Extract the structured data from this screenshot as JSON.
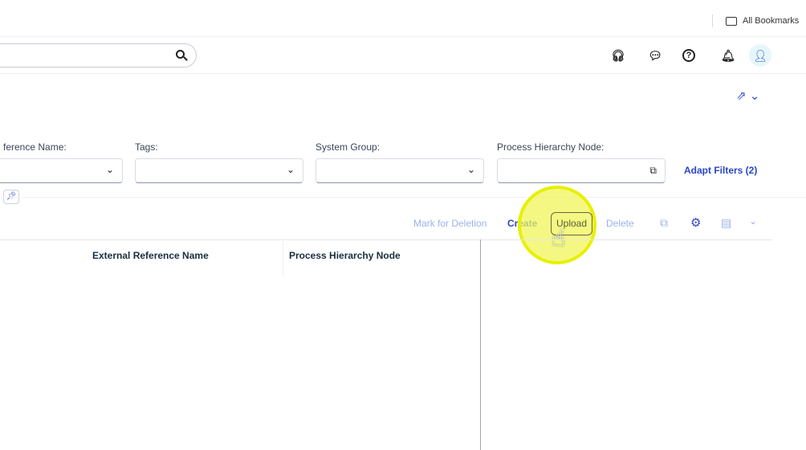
{
  "bookmarks": {
    "label": "All Bookmarks"
  },
  "shell": {
    "icons": [
      "headset-icon",
      "feedback-icon",
      "help-icon",
      "bell-icon",
      "user-icon"
    ]
  },
  "filters": [
    {
      "label": "ference Name:",
      "value": ""
    },
    {
      "label": "Tags:",
      "value": ""
    },
    {
      "label": "System Group:",
      "value": ""
    },
    {
      "label": "Process Hierarchy Node:",
      "value": ""
    }
  ],
  "adapt_filters": "Adapt Filters (2)",
  "toolbar": {
    "mark": "Mark for Deletion",
    "create": "Create",
    "upload": "Upload",
    "delete": "Delete"
  },
  "table": {
    "columns": [
      "External Reference Name",
      "Process Hierarchy Node"
    ]
  }
}
